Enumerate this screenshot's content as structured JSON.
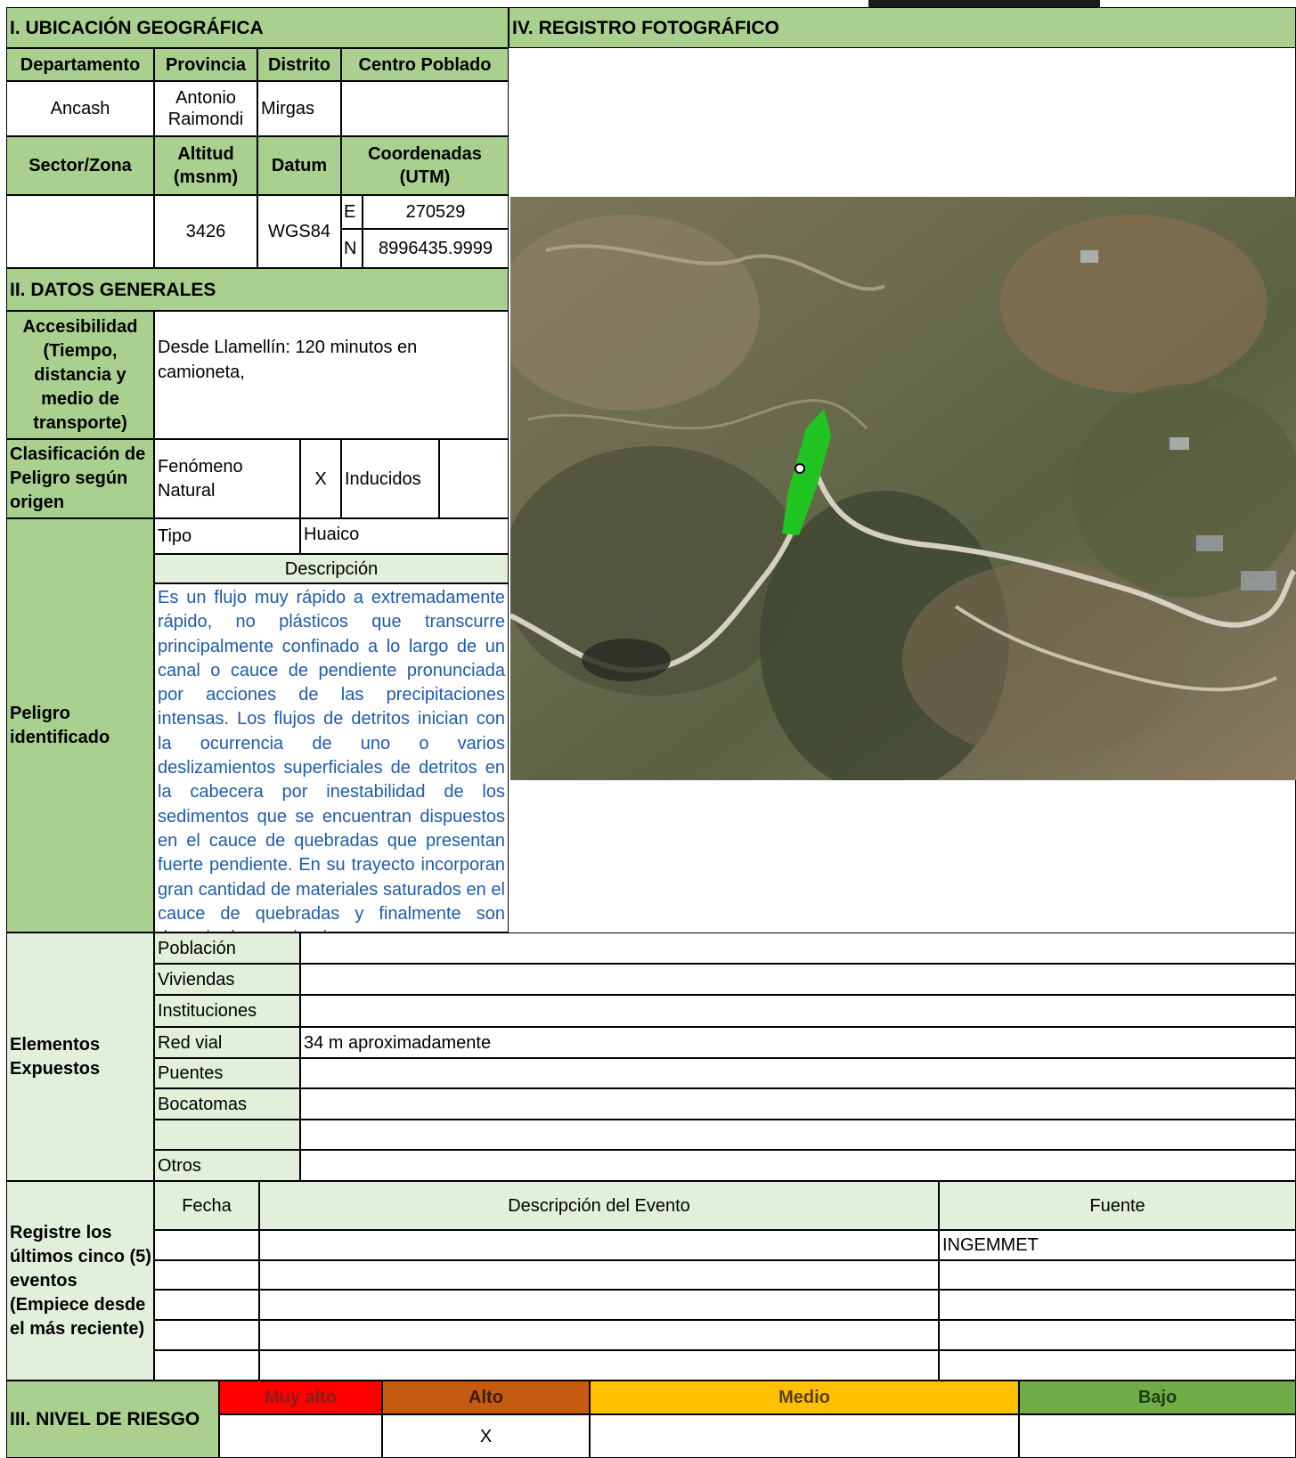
{
  "section1": {
    "title": "I. UBICACIÓN GEOGRÁFICA",
    "headers": [
      "Departamento",
      "Provincia",
      "Distrito",
      "Centro Poblado"
    ],
    "values": {
      "departamento": "Ancash",
      "provincia": "Antonio Raimondi",
      "distrito": "Mirgas",
      "centro_poblado": ""
    },
    "headers2": {
      "sector": "Sector/Zona",
      "altitud": "Altitud (msnm)",
      "datum": "Datum",
      "coords": "Coordenadas (UTM)"
    },
    "values2": {
      "sector": "",
      "altitud": "3426",
      "datum": "WGS84",
      "e_label": "E",
      "e_value": "270529",
      "n_label": "N",
      "n_value": "8996435.9999"
    }
  },
  "section4": {
    "title": "IV. REGISTRO FOTOGRÁFICO"
  },
  "section2": {
    "title": "II. DATOS GENERALES",
    "accesibilidad_label": "Accesibilidad (Tiempo, distancia y medio de transporte)",
    "accesibilidad_value": "Desde Llamellín: 120 minutos en camioneta,",
    "clasificacion_label": "Clasificación de Peligro según origen",
    "fenomeno_natural": "Fenómeno Natural",
    "fenomeno_mark": "X",
    "inducidos": "Inducidos",
    "inducidos_mark": "",
    "peligro_label": "Peligro identificado",
    "tipo_label": "Tipo",
    "tipo_value": "Huaico",
    "descripcion_label": "Descripción",
    "descripcion_value": "Es un flujo muy rápido a extremadamente rápido, no plásticos que transcurre principalmente confinado a lo largo de un canal o cauce de pendiente pronunciada por acciones de las precipitaciones intensas. Los flujos de detritos inician con la ocurrencia de uno o varios deslizamientos superficiales de detritos en la cabecera por inestabilidad de los sedimentos que se encuentran dispuestos en el cauce de quebradas que presentan fuerte pendiente. En su trayecto incorporan gran cantidad de materiales saturados en el cauce de quebradas y finalmente son depositados en abanicos"
  },
  "elementos": {
    "label": "Elementos Expuestos",
    "rows": [
      {
        "name": "Población",
        "value": ""
      },
      {
        "name": "Viviendas",
        "value": ""
      },
      {
        "name": "Instituciones",
        "value": ""
      },
      {
        "name": "Red vial",
        "value": "34 m aproximadamente"
      },
      {
        "name": "Puentes",
        "value": ""
      },
      {
        "name": "Bocatomas",
        "value": ""
      },
      {
        "name": "",
        "value": ""
      },
      {
        "name": "Otros",
        "value": ""
      }
    ]
  },
  "eventos": {
    "label": "Registre los últimos cinco (5) eventos (Empiece desde el más reciente)",
    "headers": {
      "fecha": "Fecha",
      "descripcion": "Descripción del Evento",
      "fuente": "Fuente"
    },
    "rows": [
      {
        "fecha": "",
        "descripcion": "",
        "fuente": "INGEMMET"
      },
      {
        "fecha": "",
        "descripcion": "",
        "fuente": ""
      },
      {
        "fecha": "",
        "descripcion": "",
        "fuente": ""
      },
      {
        "fecha": "",
        "descripcion": "",
        "fuente": ""
      },
      {
        "fecha": "",
        "descripcion": "",
        "fuente": ""
      }
    ]
  },
  "section3": {
    "title": "III. NIVEL DE RIESGO",
    "levels": [
      {
        "label": "Muy alto",
        "color": "#ff0000",
        "mark": ""
      },
      {
        "label": "Alto",
        "color": "#c55a11",
        "mark": "X"
      },
      {
        "label": "Medio",
        "color": "#ffc000",
        "mark": ""
      },
      {
        "label": "Bajo",
        "color": "#70ad47",
        "mark": ""
      }
    ]
  },
  "colors": {
    "header_green": "#a9d08e",
    "light_green": "#e2efda",
    "description_blue": "#1f5ba8",
    "hazard_polygon": "#21c521"
  }
}
